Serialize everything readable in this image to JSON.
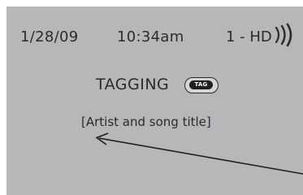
{
  "status_bar": {
    "date": "1/28/09",
    "time": "10:34am",
    "station": "1 - HD",
    "signal_icon": "signal-waves-icon"
  },
  "tagging": {
    "label": "TAGGING",
    "tag_button_label": "TAG"
  },
  "song": {
    "title_placeholder": "[Artist and song title]"
  },
  "pointer_icon": "callout-arrow-icon",
  "colors": {
    "screen_background": "#b6b7b9",
    "text": "#2b2b2d",
    "tag_button_fill": "#1f1f21"
  }
}
